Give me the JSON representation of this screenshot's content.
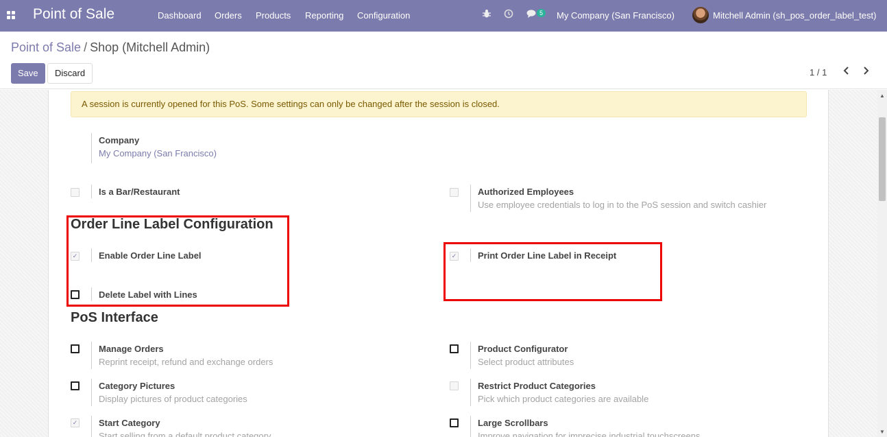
{
  "navbar": {
    "brand": "Point of Sale",
    "menu": [
      "Dashboard",
      "Orders",
      "Products",
      "Reporting",
      "Configuration"
    ],
    "messages_count": "5",
    "company": "My Company (San Francisco)",
    "user": "Mitchell Admin (sh_pos_order_label_test)"
  },
  "breadcrumb": {
    "parent": "Point of Sale",
    "separator": "/",
    "current": "Shop (Mitchell Admin)"
  },
  "actions": {
    "save": "Save",
    "discard": "Discard"
  },
  "pager": {
    "text": "1 / 1"
  },
  "alert": "A session is currently opened for this PoS. Some settings can only be changed after the session is closed.",
  "company_field": {
    "label": "Company",
    "value": "My Company (San Francisco)"
  },
  "settings_top": {
    "bar_restaurant": {
      "label": "Is a Bar/Restaurant",
      "checked": false,
      "disabled": true
    },
    "authorized_employees": {
      "label": "Authorized Employees",
      "desc": "Use employee credentials to log in to the PoS session and switch cashier",
      "checked": false,
      "disabled": true
    }
  },
  "order_line_label": {
    "title": "Order Line Label Configuration",
    "enable": {
      "label": "Enable Order Line Label",
      "checked": true
    },
    "delete_with_lines": {
      "label": "Delete Label with Lines",
      "checked": false
    },
    "print_in_receipt": {
      "label": "Print Order Line Label in Receipt",
      "checked": true
    }
  },
  "pos_interface": {
    "title": "PoS Interface",
    "manage_orders": {
      "label": "Manage Orders",
      "desc": "Reprint receipt, refund and exchange orders",
      "checked": false
    },
    "product_configurator": {
      "label": "Product Configurator",
      "desc": "Select product attributes",
      "checked": false
    },
    "category_pictures": {
      "label": "Category Pictures",
      "desc": "Display pictures of product categories",
      "checked": false
    },
    "restrict_categories": {
      "label": "Restrict Product Categories",
      "desc": "Pick which product categories are available",
      "checked": false,
      "disabled": true
    },
    "start_category": {
      "label": "Start Category",
      "desc": "Start selling from a default product category",
      "checked": true
    },
    "large_scrollbars": {
      "label": "Large Scrollbars",
      "desc": "Improve navigation for imprecise industrial touchscreens",
      "checked": false
    }
  },
  "colors": {
    "brand": "#7c7bad",
    "highlight": "#e00000",
    "alert_bg": "#fcf3cf"
  },
  "icons": [
    "apps-icon",
    "bug-icon",
    "clock-icon",
    "chat-icon",
    "chevron-left-icon",
    "chevron-right-icon"
  ]
}
